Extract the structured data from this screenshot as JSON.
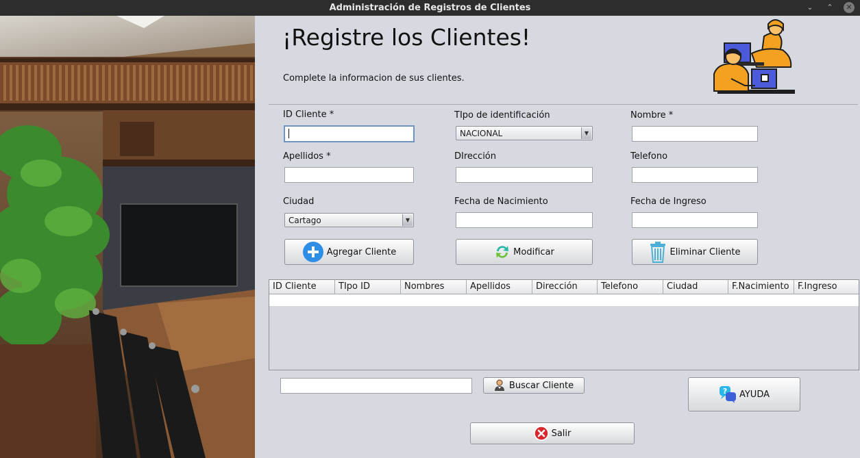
{
  "window": {
    "title": "Administración de Registros de Clientes"
  },
  "header": {
    "title": "¡Registre los Clientes!",
    "subtitle": "Complete la informacion de sus clientes."
  },
  "form": {
    "id_cliente": {
      "label": "ID Cliente *",
      "value": ""
    },
    "tipo_identificacion": {
      "label": "TIpo de identificación",
      "selected": "NACIONAL"
    },
    "nombre": {
      "label": "Nombre *",
      "value": ""
    },
    "apellidos": {
      "label": "Apellidos *",
      "value": ""
    },
    "direccion": {
      "label": "DIrección",
      "value": ""
    },
    "telefono": {
      "label": "Telefono",
      "value": ""
    },
    "ciudad": {
      "label": "Ciudad",
      "selected": "Cartago"
    },
    "fecha_nacimiento": {
      "label": "Fecha de Nacimiento",
      "value": ""
    },
    "fecha_ingreso": {
      "label": "Fecha de Ingreso",
      "value": ""
    }
  },
  "actions": {
    "agregar": "Agregar Cliente",
    "modificar": "Modificar",
    "eliminar": "Eliminar Cliente",
    "buscar": "Buscar Cliente",
    "ayuda": "AYUDA",
    "salir": "Salir"
  },
  "search": {
    "value": ""
  },
  "table": {
    "columns": [
      "ID Cliente",
      "TIpo ID",
      "Nombres",
      "Apellidos",
      "Dirección",
      "Telefono",
      "Ciudad",
      "F.Nacimiento",
      "F.Ingreso"
    ],
    "rows": []
  },
  "icons": {
    "add": "plus-circle-icon",
    "modify": "refresh-icon",
    "delete": "trash-icon",
    "search": "user-search-icon",
    "help": "help-chat-icon",
    "exit": "close-circle-icon"
  },
  "colors": {
    "titlebar": "#2d2d2d",
    "panel": "#d6d9df",
    "add_icon": "#2e8ee6",
    "exit_icon": "#d9262c"
  }
}
